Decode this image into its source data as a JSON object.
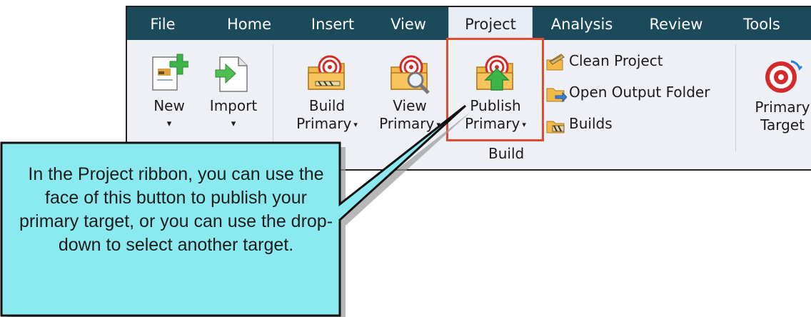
{
  "tabs": [
    {
      "label": "File"
    },
    {
      "label": "Home"
    },
    {
      "label": "Insert"
    },
    {
      "label": "View"
    },
    {
      "label": "Project",
      "active": true
    },
    {
      "label": "Analysis"
    },
    {
      "label": "Review"
    },
    {
      "label": "Tools"
    }
  ],
  "ribbon": {
    "new": {
      "line1": "New",
      "caret": "▾"
    },
    "import": {
      "line1": "Import",
      "caret": "▾"
    },
    "build_primary": {
      "line1": "Build",
      "line2": "Primary",
      "caret": "▾"
    },
    "view_primary": {
      "line1": "View",
      "line2": "Primary",
      "caret": "▾"
    },
    "publish_primary": {
      "line1": "Publish",
      "line2": "Primary",
      "caret": "▾"
    },
    "clean_project": "Clean Project",
    "open_output_folder": "Open Output Folder",
    "builds": "Builds",
    "group_label": "Build",
    "primary_target": {
      "line1": "Primary",
      "line2": "Target"
    }
  },
  "callout": {
    "text": "In the Project ribbon, you can use the face of this button to publish your primary target, or you can use the drop-down to select another target."
  },
  "colors": {
    "tabbar": "#1b4a5a",
    "ribbon_bg": "#eef0f5",
    "highlight": "#e34a2e",
    "callout_fill": "#8beaf0"
  },
  "icons": [
    "new-document-icon",
    "import-icon",
    "build-primary-icon",
    "view-primary-icon",
    "publish-primary-icon",
    "clean-project-icon",
    "open-folder-icon",
    "builds-icon",
    "target-icon",
    "dropdown-caret-icon"
  ]
}
